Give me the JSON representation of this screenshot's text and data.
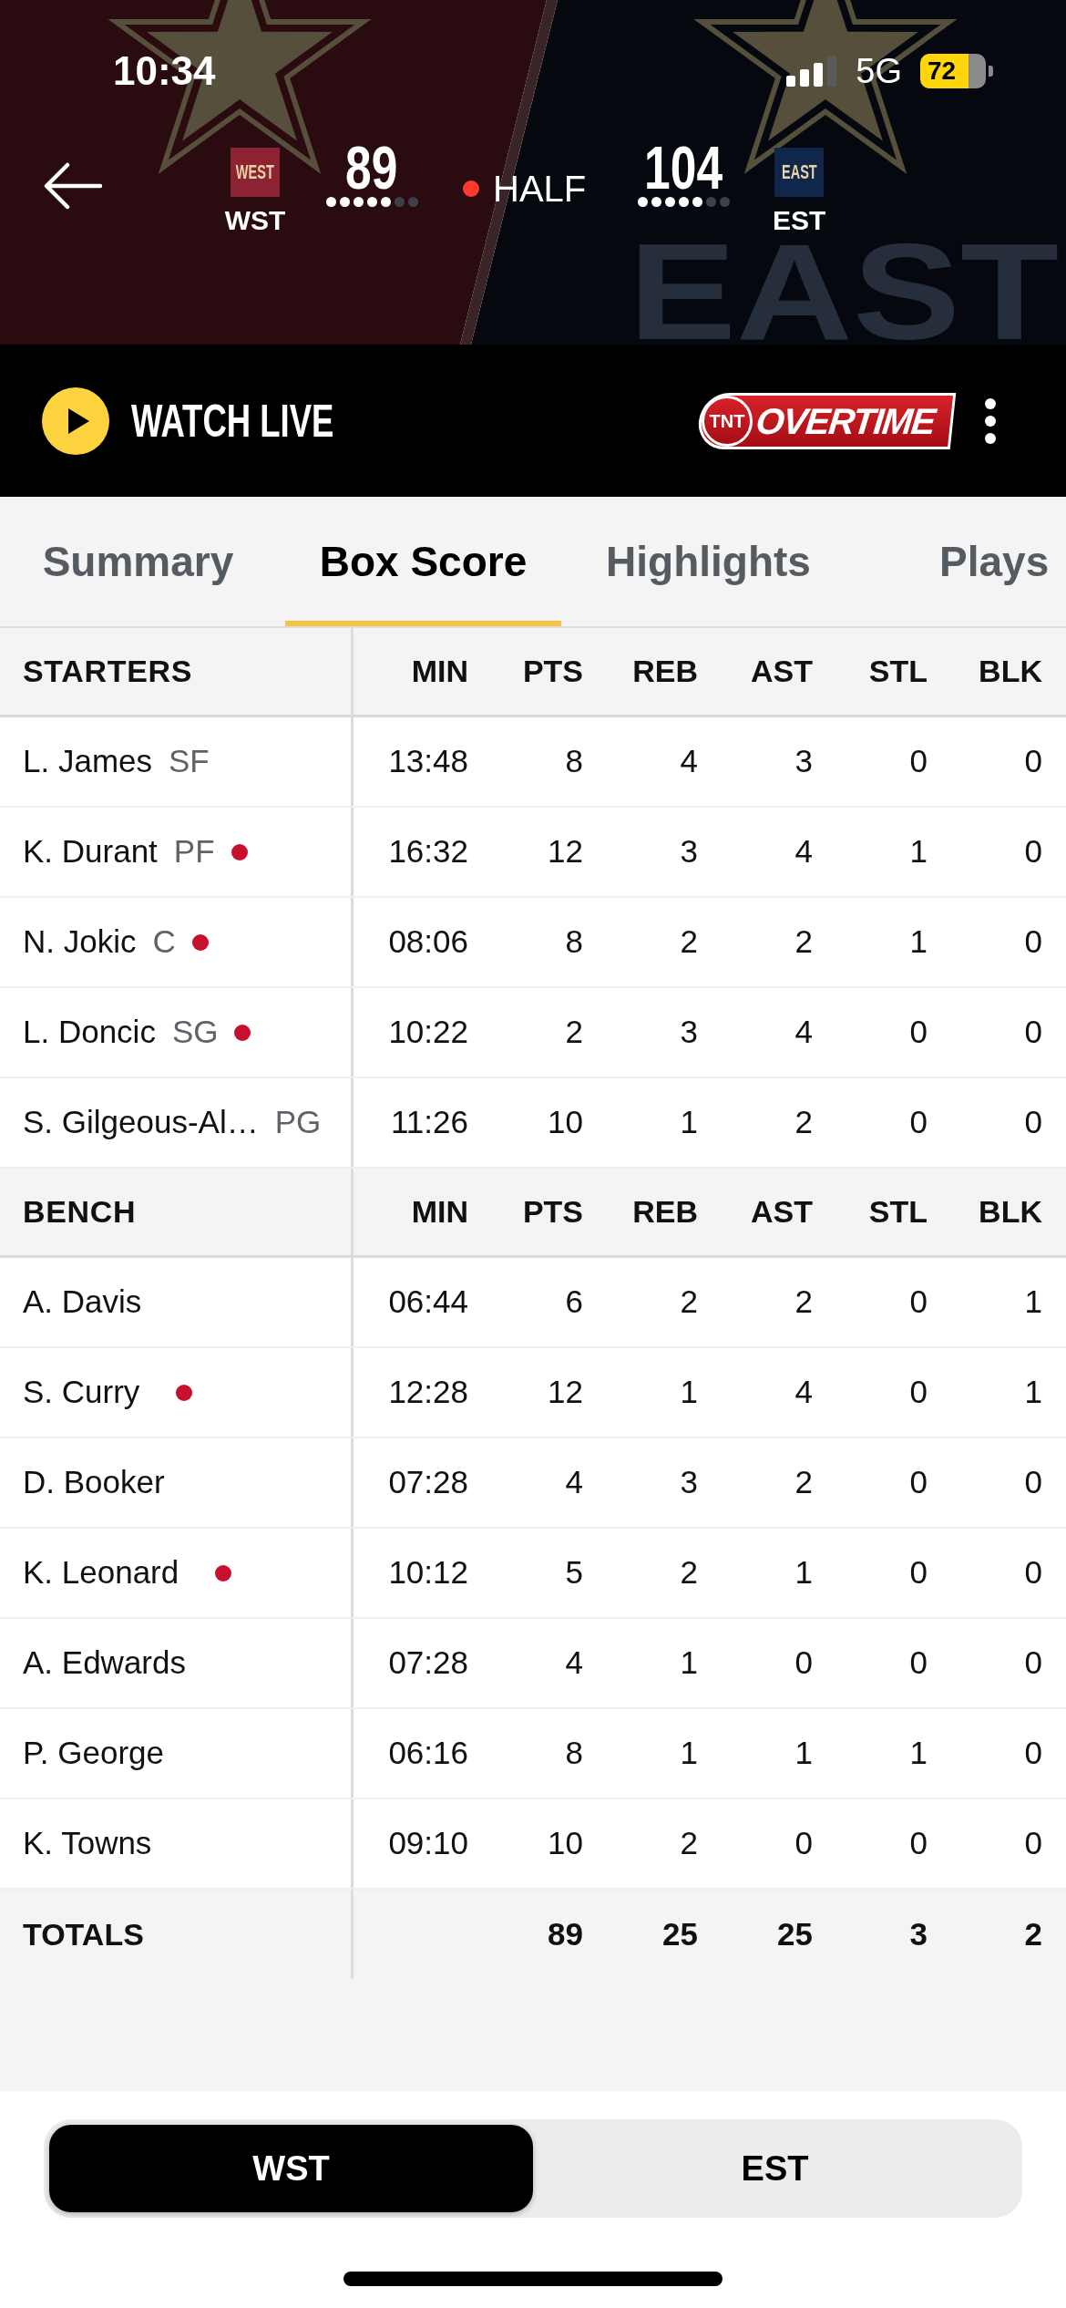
{
  "status_bar": {
    "time": "10:34",
    "network": "5G",
    "battery": "72"
  },
  "scoreboard": {
    "backdrop_word": "EAST",
    "period": {
      "label": "HALF",
      "live": true
    },
    "teams": [
      {
        "logo_text": "WEST",
        "abbr": "WST",
        "score": "89",
        "color": "#8c2332",
        "timeouts": [
          {
            "left": true
          },
          {
            "left": true
          },
          {
            "left": true
          },
          {
            "left": true
          },
          {
            "left": true
          },
          {
            "left": false
          },
          {
            "left": false
          }
        ]
      },
      {
        "logo_text": "EAST",
        "abbr": "EST",
        "score": "104",
        "color": "#10264a",
        "timeouts": [
          {
            "left": true
          },
          {
            "left": true
          },
          {
            "left": true
          },
          {
            "left": true
          },
          {
            "left": true
          },
          {
            "left": false
          },
          {
            "left": false
          }
        ]
      }
    ]
  },
  "watch_bar": {
    "label": "WATCH LIVE",
    "logo": {
      "badge": "TNT",
      "wordmark": "OVERTIME"
    }
  },
  "tabs": [
    {
      "label": "Summary",
      "selected": false
    },
    {
      "label": "Box Score",
      "selected": true
    },
    {
      "label": "Highlights",
      "selected": false
    },
    {
      "label": "Plays",
      "selected": false
    }
  ],
  "box_score": {
    "groups": [
      {
        "title": "STARTERS",
        "columns": [
          "MIN",
          "PTS",
          "REB",
          "AST",
          "STL",
          "BLK"
        ],
        "rows": [
          {
            "name": "L. James",
            "position": "SF",
            "on_court": false,
            "stats": [
              "13:48",
              "8",
              "4",
              "3",
              "0",
              "0"
            ]
          },
          {
            "name": "K. Durant",
            "position": "PF",
            "on_court": true,
            "stats": [
              "16:32",
              "12",
              "3",
              "4",
              "1",
              "0"
            ]
          },
          {
            "name": "N. Jokic",
            "position": "C",
            "on_court": true,
            "stats": [
              "08:06",
              "8",
              "2",
              "2",
              "1",
              "0"
            ]
          },
          {
            "name": "L. Doncic",
            "position": "SG",
            "on_court": true,
            "stats": [
              "10:22",
              "2",
              "3",
              "4",
              "0",
              "0"
            ]
          },
          {
            "name": "S. Gilgeous-Al…",
            "position": "PG",
            "on_court": false,
            "stats": [
              "11:26",
              "10",
              "1",
              "2",
              "0",
              "0"
            ]
          }
        ]
      },
      {
        "title": "BENCH",
        "columns": [
          "MIN",
          "PTS",
          "REB",
          "AST",
          "STL",
          "BLK"
        ],
        "rows": [
          {
            "name": "A. Davis",
            "on_court": false,
            "stats": [
              "06:44",
              "6",
              "2",
              "2",
              "0",
              "1"
            ]
          },
          {
            "name": "S. Curry",
            "on_court": true,
            "stats": [
              "12:28",
              "12",
              "1",
              "4",
              "0",
              "1"
            ]
          },
          {
            "name": "D. Booker",
            "on_court": false,
            "stats": [
              "07:28",
              "4",
              "3",
              "2",
              "0",
              "0"
            ]
          },
          {
            "name": "K. Leonard",
            "on_court": true,
            "stats": [
              "10:12",
              "5",
              "2",
              "1",
              "0",
              "0"
            ]
          },
          {
            "name": "A. Edwards",
            "on_court": false,
            "stats": [
              "07:28",
              "4",
              "1",
              "0",
              "0",
              "0"
            ]
          },
          {
            "name": "P. George",
            "on_court": false,
            "stats": [
              "06:16",
              "8",
              "1",
              "1",
              "1",
              "0"
            ]
          },
          {
            "name": "K. Towns",
            "on_court": false,
            "stats": [
              "09:10",
              "10",
              "2",
              "0",
              "0",
              "0"
            ]
          }
        ]
      }
    ],
    "totals": {
      "label": "TOTALS",
      "stats": [
        "89",
        "25",
        "25",
        "3",
        "2"
      ]
    }
  },
  "team_switch": [
    {
      "label": "WST",
      "selected": true
    },
    {
      "label": "EST",
      "selected": false
    }
  ]
}
